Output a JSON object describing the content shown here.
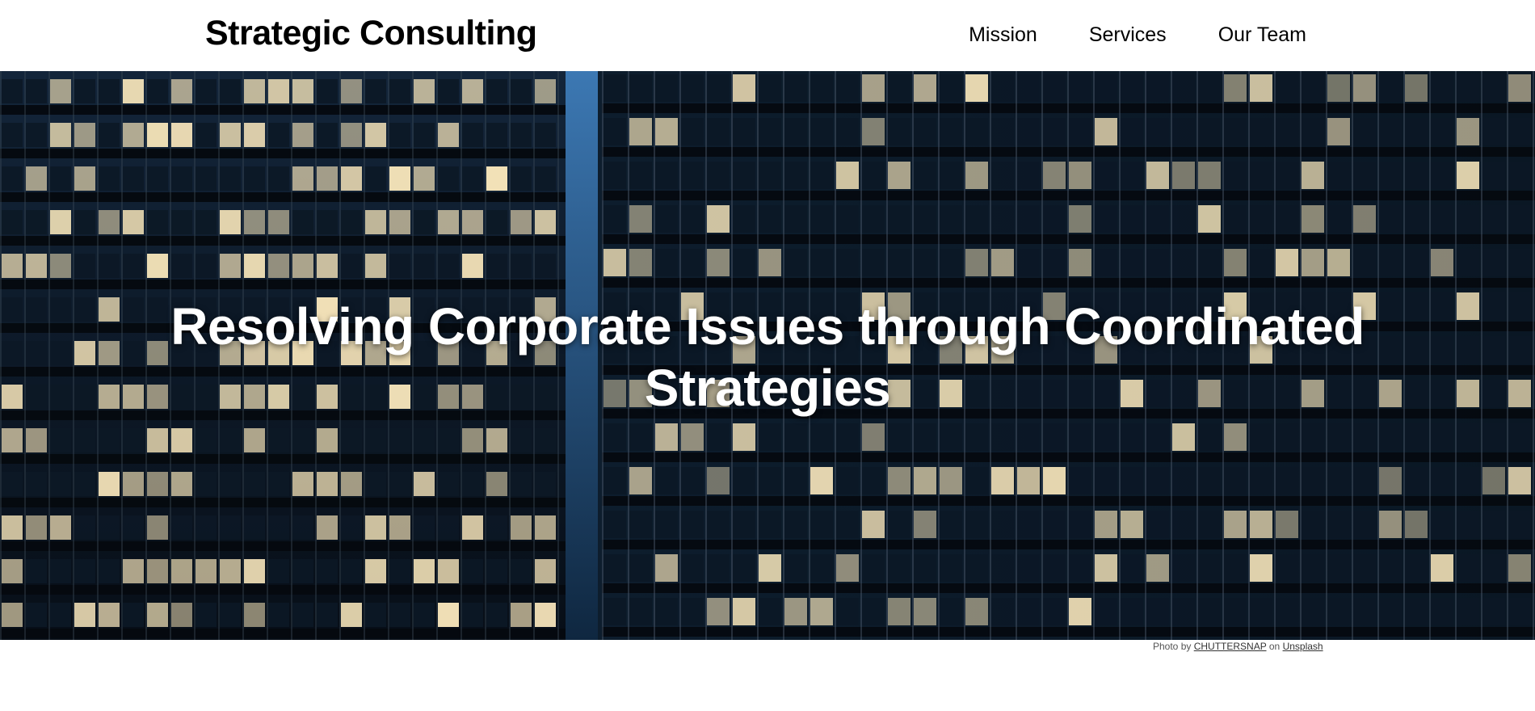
{
  "header": {
    "brand": "Strategic Consulting",
    "nav": [
      {
        "label": "Mission"
      },
      {
        "label": "Services"
      },
      {
        "label": "Our Team"
      }
    ]
  },
  "hero": {
    "title": "Resolving Corporate Issues through Coordinated Strategies",
    "image_description_icon": "office-buildings-night-photo"
  },
  "credit": {
    "prefix": "Photo by",
    "author": "CHUTTERSNAP",
    "middle": "on",
    "source": "Unsplash"
  },
  "colors": {
    "background": "#ffffff",
    "text": "#000000",
    "hero_text": "#ffffff",
    "window_lit": "#f3e2b8",
    "window_dark": "#0c1826",
    "facade": "#09121d"
  }
}
